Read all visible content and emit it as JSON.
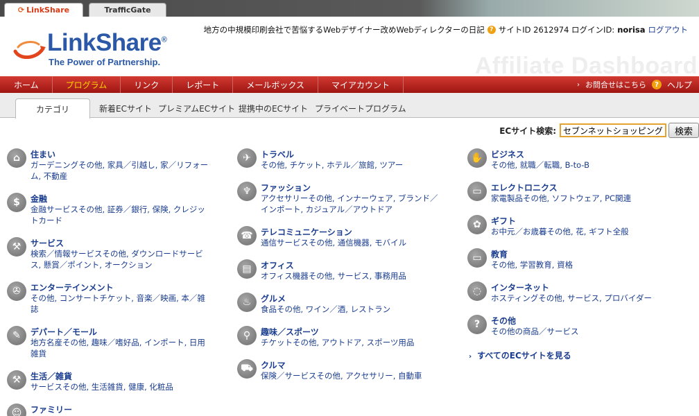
{
  "tabs": {
    "linkshare": "LinkShare",
    "trafficgate": "TrafficGate"
  },
  "header": {
    "logo_word": "LinkShare",
    "logo_tagline": "The Power of Partnership.",
    "site_name": "地方の中規模印刷会社で苦悩するWebデザイナー改めWebディレクターの日記",
    "site_id_text": "サイトID 2612974 ログインID:",
    "login_id": "norisa",
    "logout": "ログアウト",
    "watermark": "Affiliate Dashboard"
  },
  "nav": {
    "items": [
      "ホーム",
      "プログラム",
      "リンク",
      "レポート",
      "メールボックス",
      "マイアカウント"
    ],
    "contact": "お問合せはこちら",
    "help": "ヘルプ"
  },
  "subnav": {
    "items": [
      "カテゴリ",
      "新着ECサイト",
      "プレミアムECサイト",
      "提携中のECサイト",
      "プライベートプログラム"
    ]
  },
  "search": {
    "label": "ECサイト検索:",
    "value": "セブンネットショッピング",
    "button": "検索"
  },
  "categories": [
    {
      "icon": "house-icon",
      "glyph": "⌂",
      "title": "住まい",
      "subs": "ガーデニングその他, 家具／引越し, 家／リフォーム, 不動産"
    },
    {
      "icon": "dollar-icon",
      "glyph": "$",
      "title": "金融",
      "subs": "金融サービスその他, 証券／銀行, 保険, クレジットカード"
    },
    {
      "icon": "hammer-icon",
      "glyph": "⚒",
      "title": "サービス",
      "subs": "検索／情報サービスその他, ダウンロードサービス, 懸賞／ポイント, オークション"
    },
    {
      "icon": "film-reel-icon",
      "glyph": "✇",
      "title": "エンターテインメント",
      "subs": "その他, コンサートチケット, 音楽／映画, 本／雑誌"
    },
    {
      "icon": "tag-icon",
      "glyph": "✎",
      "title": "デパート／モール",
      "subs": "地方名産その他, 趣味／嗜好品, インポート, 日用雑貨"
    },
    {
      "icon": "hammer-icon",
      "glyph": "⚒",
      "title": "生活／雑貨",
      "subs": "サービスその他, 生活雑貨, 健康, 化粧品"
    },
    {
      "icon": "family-icon",
      "glyph": "☺",
      "title": "ファミリー",
      "subs": ""
    },
    {
      "icon": "airplane-icon",
      "glyph": "✈",
      "title": "トラベル",
      "subs": "その他, チケット, ホテル／旅館, ツアー"
    },
    {
      "icon": "shirt-icon",
      "glyph": "♆",
      "title": "ファッション",
      "subs": "アクセサリーその他, インナーウェア, ブランド／インポート, カジュアル／アウトドア"
    },
    {
      "icon": "mobile-phone-icon",
      "glyph": "☎",
      "title": "テレコミュニケーション",
      "subs": "通信サービスその他, 通信機器, モバイル"
    },
    {
      "icon": "printer-icon",
      "glyph": "▤",
      "title": "オフィス",
      "subs": "オフィス機器その他, サービス, 事務用品"
    },
    {
      "icon": "utensils-icon",
      "glyph": "♨",
      "title": "グルメ",
      "subs": "食品その他, ワイン／酒, レストラン"
    },
    {
      "icon": "bicycle-icon",
      "glyph": "⚲",
      "title": "趣味／スポーツ",
      "subs": "チケットその他, アウトドア, スポーツ用品"
    },
    {
      "icon": "car-icon",
      "glyph": "⛟",
      "title": "クルマ",
      "subs": "保険／サービスその他, アクセサリー, 自動車"
    },
    {
      "icon": "handshake-icon",
      "glyph": "✋",
      "title": "ビジネス",
      "subs": "その他, 就職／転職, B-to-B"
    },
    {
      "icon": "monitor-icon",
      "glyph": "▭",
      "title": "エレクトロニクス",
      "subs": "家電製品その他, ソフトウェア, PC関連"
    },
    {
      "icon": "gift-icon",
      "glyph": "✿",
      "title": "ギフト",
      "subs": "お中元／お歳暮その他, 花, ギフト全般"
    },
    {
      "icon": "laptop-icon",
      "glyph": "▭",
      "title": "教育",
      "subs": "その他, 学習教育, 資格"
    },
    {
      "icon": "mouse-icon",
      "glyph": "◌",
      "title": "インターネット",
      "subs": "ホスティングその他, サービス, プロバイダー"
    },
    {
      "icon": "question-icon",
      "glyph": "?",
      "title": "その他",
      "subs": "その他の商品／サービス"
    }
  ],
  "all_sites": "すべてのECサイトを見る"
}
